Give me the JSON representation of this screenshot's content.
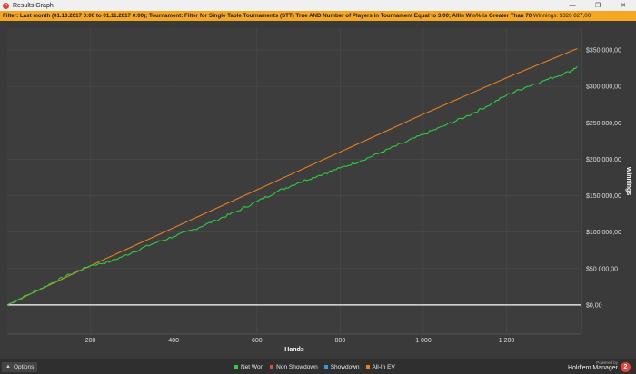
{
  "window": {
    "title": "Results Graph",
    "icon": "hem-logo-icon"
  },
  "filter": {
    "text": "Filter: Last month (01.10.2017 0:00 to 01.11.2017 0:00); Tournament: Filter for Single Table Tournaments (STT) True AND Number of Players in Tournament Equal to 3.00; Allin Win% is Greater Than 70",
    "winnings": "Winnings: $326 827,00"
  },
  "colors": {
    "background": "#3a3a3a",
    "filter_bar": "#f5a623",
    "net_won": "#2ecc40",
    "non_showdown": "#e74c3c",
    "showdown": "#3498db",
    "allin_ev": "#e67e22",
    "zero_line": "#ffffff"
  },
  "chart_data": {
    "type": "line",
    "xlabel": "Hands",
    "ylabel": "Winnings",
    "xlim": [
      0,
      1380
    ],
    "ylim": [
      -40000,
      380000
    ],
    "x_ticks": [
      200,
      400,
      600,
      800,
      1000,
      1200
    ],
    "x_tick_labels": [
      "200",
      "400",
      "600",
      "800",
      "1 000",
      "1 200"
    ],
    "y_ticks": [
      0,
      50000,
      100000,
      150000,
      200000,
      250000,
      300000,
      350000
    ],
    "y_tick_labels": [
      "$0,00",
      "$50 000,00",
      "$100 000,00",
      "$150 000,00",
      "$200 000,00",
      "$250 000,00",
      "$300 000,00",
      "$350 000,00"
    ],
    "grid": true,
    "legend_position": "bottom",
    "series": [
      {
        "name": "Net Won",
        "color": "#2ecc40",
        "x": [
          0,
          50,
          100,
          150,
          200,
          250,
          300,
          350,
          400,
          450,
          500,
          550,
          600,
          650,
          700,
          750,
          800,
          850,
          900,
          950,
          1000,
          1050,
          1100,
          1150,
          1200,
          1250,
          1300,
          1350,
          1370
        ],
        "y": [
          0,
          14000,
          28000,
          42000,
          54000,
          60000,
          72000,
          84000,
          94000,
          104000,
          116000,
          128000,
          142000,
          156000,
          168000,
          178000,
          188000,
          198000,
          210000,
          222000,
          234000,
          246000,
          258000,
          272000,
          288000,
          300000,
          310000,
          320000,
          326827
        ]
      },
      {
        "name": "Non Showdown",
        "color": "#e74c3c",
        "x": [
          0,
          1370
        ],
        "y": [
          0,
          0
        ]
      },
      {
        "name": "Showdown",
        "color": "#3498db",
        "x": [
          0,
          1370
        ],
        "y": [
          0,
          0
        ]
      },
      {
        "name": "All-In EV",
        "color": "#e67e22",
        "x": [
          0,
          200,
          400,
          600,
          800,
          1000,
          1200,
          1370
        ],
        "y": [
          0,
          54000,
          106000,
          158000,
          210000,
          262000,
          312000,
          352000
        ]
      }
    ]
  },
  "bottombar": {
    "options_label": "Options",
    "legend": [
      {
        "label": "Net Won",
        "color": "#2ecc40"
      },
      {
        "label": "Non Showdown",
        "color": "#e74c3c"
      },
      {
        "label": "Showdown",
        "color": "#3498db"
      },
      {
        "label": "All-In EV",
        "color": "#e67e22"
      }
    ],
    "powered_by": "Powered by",
    "brand": "Hold'em Manager",
    "brand_badge": "2"
  }
}
